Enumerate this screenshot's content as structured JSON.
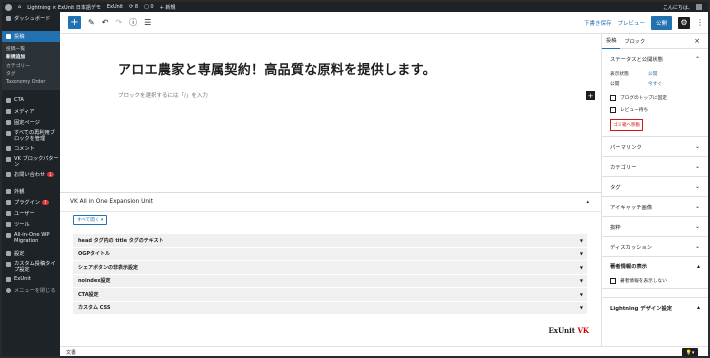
{
  "admin_bar": {
    "site_name": "Lightning × ExUnit 日本語デモ",
    "exunit": "ExUnit",
    "updates": "8",
    "comments": "0",
    "new": "+ 新規",
    "greeting": "こんにちは、"
  },
  "sidebar": {
    "dashboard": "ダッシュボード",
    "posts": "投稿",
    "posts_sub": [
      "投稿一覧",
      "新規追加",
      "カテゴリー",
      "タグ",
      "Taxonomy Order"
    ],
    "items": [
      {
        "label": "CTA",
        "icon": "cta-icon"
      },
      {
        "label": "メディア",
        "icon": "media-icon"
      },
      {
        "label": "固定ページ",
        "icon": "page-icon"
      },
      {
        "label": "すべての再利用ブロックを管理",
        "icon": "reusable-icon"
      },
      {
        "label": "コメント",
        "icon": "comment-icon"
      },
      {
        "label": "VK ブロックパターン",
        "icon": "pattern-icon"
      },
      {
        "label": "お問い合わせ",
        "icon": "mail-icon",
        "badge": "1"
      },
      {
        "label": "外観",
        "icon": "appearance-icon"
      },
      {
        "label": "プラグイン",
        "icon": "plugin-icon",
        "badge": "7"
      },
      {
        "label": "ユーザー",
        "icon": "user-icon"
      },
      {
        "label": "ツール",
        "icon": "tool-icon"
      },
      {
        "label": "All-in-One WP Migration",
        "icon": "migration-icon"
      },
      {
        "label": "設定",
        "icon": "settings-icon"
      },
      {
        "label": "カスタム投稿タイプ設定",
        "icon": "cpt-icon"
      },
      {
        "label": "ExUnit",
        "icon": "exunit-icon"
      },
      {
        "label": "メニューを閉じる",
        "icon": "collapse-icon"
      }
    ]
  },
  "toolbar": {
    "add": "+",
    "save_draft": "下書き保存",
    "preview": "プレビュー",
    "publish": "公開"
  },
  "editor": {
    "title": "アロエ農家と専属契約！高品質な原料を提供します。",
    "placeholder": "ブロックを選択するには「/」を入力"
  },
  "metabox": {
    "title": "VK All in One Expansion Unit",
    "toggle": "すべて開く ▾",
    "rows": [
      "head タグ内の title タグのテキスト",
      "OGPタイトル",
      "シェアボタンの非表示設定",
      "noindex設定",
      "CTA設定",
      "カスタム CSS"
    ],
    "logo_ex": "ExUnit",
    "logo_vk": "VK"
  },
  "footer": {
    "breadcrumb": "文書"
  },
  "settings": {
    "tabs": [
      "投稿",
      "ブロック"
    ],
    "status_title": "ステータスと公開状態",
    "visibility_label": "表示状態",
    "visibility_value": "公開",
    "publish_label": "公開",
    "publish_value": "今すぐ",
    "sticky": "ブログのトップに固定",
    "pending": "レビュー待ち",
    "trash": "ゴミ箱へ移動",
    "panels": [
      "パーマリンク",
      "カテゴリー",
      "タグ",
      "アイキャッチ画像",
      "抜粋",
      "ディスカッション"
    ],
    "author_info_title": "著者情報の表示",
    "author_info_check": "著者情報を表示しない",
    "lightning_title": "Lightning デザイン設定"
  }
}
